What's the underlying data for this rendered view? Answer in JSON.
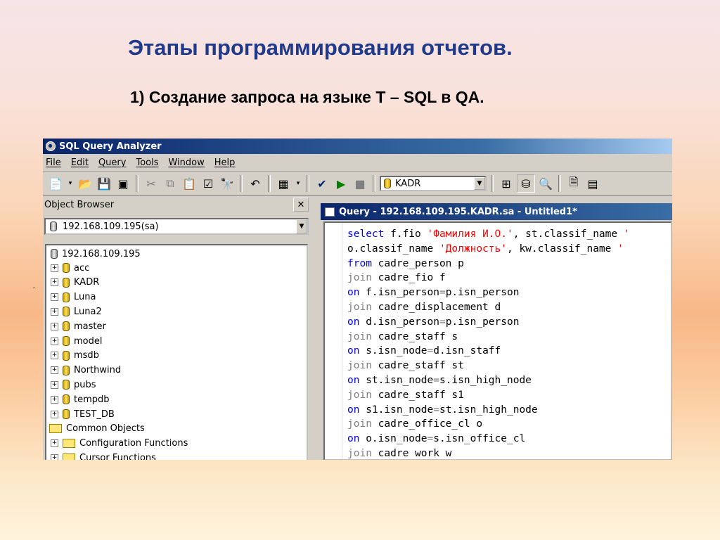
{
  "slide": {
    "title": "Этапы программирования отчетов.",
    "subtitle": "1) Создание запроса на языке T – SQL в QA."
  },
  "app": {
    "title": "SQL Query Analyzer",
    "menu": [
      "File",
      "Edit",
      "Query",
      "Tools",
      "Window",
      "Help"
    ],
    "toolbar": {
      "database": "KADR"
    }
  },
  "object_browser": {
    "title": "Object Browser",
    "server_combo": "192.168.109.195(sa)",
    "root": "192.168.109.195",
    "databases": [
      "acc",
      "KADR",
      "Luna",
      "Luna2",
      "master",
      "model",
      "msdb",
      "Northwind",
      "pubs",
      "tempdb",
      "TEST_DB"
    ],
    "common_objects": "Common Objects",
    "folders": [
      "Configuration Functions",
      "Cursor Functions"
    ]
  },
  "query_window": {
    "title": "Query - 192.168.109.195.KADR.sa - Untitled1*",
    "lines": [
      [
        [
          "kw",
          "select"
        ],
        [
          "tx",
          " f.fio "
        ],
        [
          "st",
          "'Фамилия И.О.'"
        ],
        [
          "tx",
          ", st.classif_name "
        ],
        [
          "st",
          "'"
        ]
      ],
      [
        [
          "tx",
          "o.classif_name "
        ],
        [
          "st",
          "'Должность'"
        ],
        [
          "tx",
          ", kw.classif_name "
        ],
        [
          "st",
          "'"
        ]
      ],
      [
        [
          "kw",
          "from"
        ],
        [
          "tx",
          " cadre_person p"
        ]
      ],
      [
        [
          "gr",
          "join"
        ],
        [
          "tx",
          " cadre_fio f"
        ]
      ],
      [
        [
          "kw",
          "on"
        ],
        [
          "tx",
          " f.isn_person"
        ],
        [
          "gr",
          "="
        ],
        [
          "tx",
          "p.isn_person"
        ]
      ],
      [
        [
          "gr",
          "join"
        ],
        [
          "tx",
          " cadre_displacement d"
        ]
      ],
      [
        [
          "kw",
          "on"
        ],
        [
          "tx",
          " d.isn_person"
        ],
        [
          "gr",
          "="
        ],
        [
          "tx",
          "p.isn_person"
        ]
      ],
      [
        [
          "gr",
          "join"
        ],
        [
          "tx",
          " cadre_staff s"
        ]
      ],
      [
        [
          "kw",
          "on"
        ],
        [
          "tx",
          " s.isn_node"
        ],
        [
          "gr",
          "="
        ],
        [
          "tx",
          "d.isn_staff"
        ]
      ],
      [
        [
          "gr",
          "join"
        ],
        [
          "tx",
          " cadre_staff st"
        ]
      ],
      [
        [
          "kw",
          "on"
        ],
        [
          "tx",
          " st.isn_node"
        ],
        [
          "gr",
          "="
        ],
        [
          "tx",
          "s.isn_high_node"
        ]
      ],
      [
        [
          "gr",
          "join"
        ],
        [
          "tx",
          " cadre_staff s1"
        ]
      ],
      [
        [
          "kw",
          "on"
        ],
        [
          "tx",
          " s1.isn_node"
        ],
        [
          "gr",
          "="
        ],
        [
          "tx",
          "st.isn_high_node"
        ]
      ],
      [
        [
          "gr",
          "join"
        ],
        [
          "tx",
          " cadre_office_cl o"
        ]
      ],
      [
        [
          "kw",
          "on"
        ],
        [
          "tx",
          " o.isn_node"
        ],
        [
          "gr",
          "="
        ],
        [
          "tx",
          "s.isn_office_cl"
        ]
      ],
      [
        [
          "gr",
          "join"
        ],
        [
          "tx",
          " cadre work w"
        ]
      ]
    ]
  }
}
